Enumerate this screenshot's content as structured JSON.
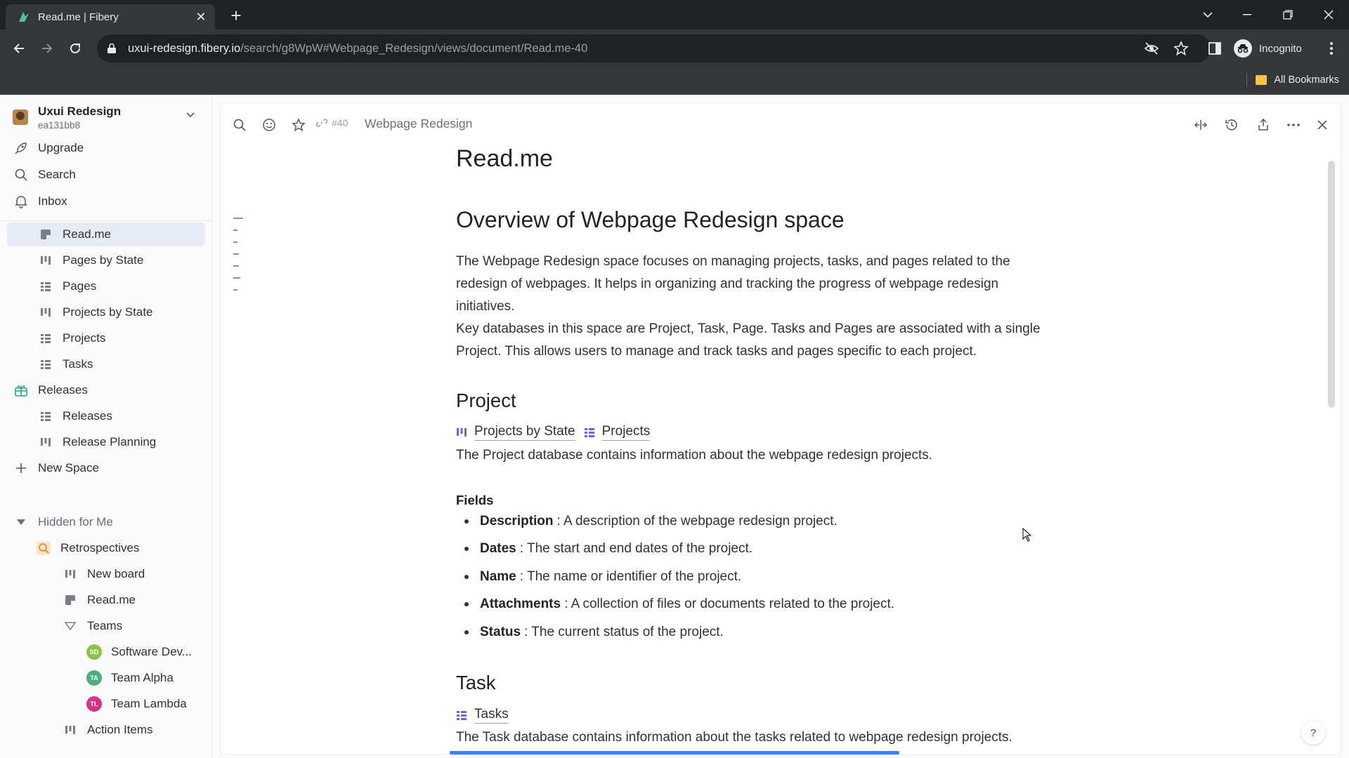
{
  "browser": {
    "tab_title": "Read.me | Fibery",
    "url_host": "uxui-redesign.fibery.io",
    "url_path": "/search/g8WpW#Webpage_Redesign/views/document/Read.me-40",
    "profile": "Incognito",
    "bookmarks_label": "All Bookmarks"
  },
  "workspace": {
    "name": "Uxui Redesign",
    "id": "ea131bb8"
  },
  "top_nav": [
    {
      "label": "Upgrade",
      "icon": "rocket-icon"
    },
    {
      "label": "Search",
      "icon": "search-icon"
    },
    {
      "label": "Inbox",
      "icon": "bell-icon"
    }
  ],
  "sidebar": {
    "space_items": [
      {
        "label": "Read.me",
        "icon": "document-icon",
        "selected": true
      },
      {
        "label": "Pages by State",
        "icon": "board-icon"
      },
      {
        "label": "Pages",
        "icon": "table-icon"
      },
      {
        "label": "Projects by State",
        "icon": "board-icon"
      },
      {
        "label": "Projects",
        "icon": "table-icon"
      },
      {
        "label": "Tasks",
        "icon": "table-icon"
      }
    ],
    "releases_space": "Releases",
    "releases_items": [
      {
        "label": "Releases",
        "icon": "table-icon"
      },
      {
        "label": "Release Planning",
        "icon": "board-icon"
      }
    ],
    "new_space": "New Space",
    "hidden_section": "Hidden for Me",
    "retrospectives": "Retrospectives",
    "retro_items": [
      {
        "label": "New board",
        "icon": "board-icon"
      },
      {
        "label": "Read.me",
        "icon": "document-icon"
      }
    ],
    "teams_label": "Teams",
    "teams": [
      {
        "label": "Software Dev...",
        "initials": "SD",
        "color": "#8bc34a"
      },
      {
        "label": "Team Alpha",
        "initials": "TA",
        "color": "#4caf7d"
      },
      {
        "label": "Team Lambda",
        "initials": "TL",
        "color": "#d63384"
      }
    ],
    "action_items": "Action Items"
  },
  "doc_header": {
    "id": "#40",
    "breadcrumb": "Webpage Redesign"
  },
  "doc": {
    "title": "Read.me",
    "overview_heading": "Overview of Webpage Redesign space",
    "overview_lines": [
      "The Webpage Redesign space focuses on managing projects, tasks, and pages related to the",
      "redesign of webpages. It helps in organizing and tracking the progress of webpage redesign",
      "initiatives.",
      "Key databases in this space are Project, Task, Page. Tasks and Pages are associated with a single",
      "Project. This allows users to manage and track tasks and pages specific to each project."
    ],
    "project_heading": "Project",
    "project_links": [
      "Projects by State",
      "Projects"
    ],
    "project_desc": "The Project database contains information about the webpage redesign projects.",
    "fields_heading": "Fields",
    "fields": [
      {
        "name": "Description",
        "text": ": A description of the webpage redesign project."
      },
      {
        "name": "Dates",
        "text": ": The start and end dates of the project."
      },
      {
        "name": "Name",
        "text": ": The name or identifier of the project."
      },
      {
        "name": "Attachments",
        "text": ": A collection of files or documents related to the project."
      },
      {
        "name": "Status",
        "text": ": The current status of the project."
      }
    ],
    "task_heading": "Task",
    "task_link": "Tasks",
    "task_desc": "The Task database contains information about the tasks related to webpage redesign projects."
  },
  "help_label": "?",
  "colors": {
    "accent": "#3b82f6",
    "selected_bg": "#e6ebf5",
    "view_icon": "#5b6ee8"
  }
}
